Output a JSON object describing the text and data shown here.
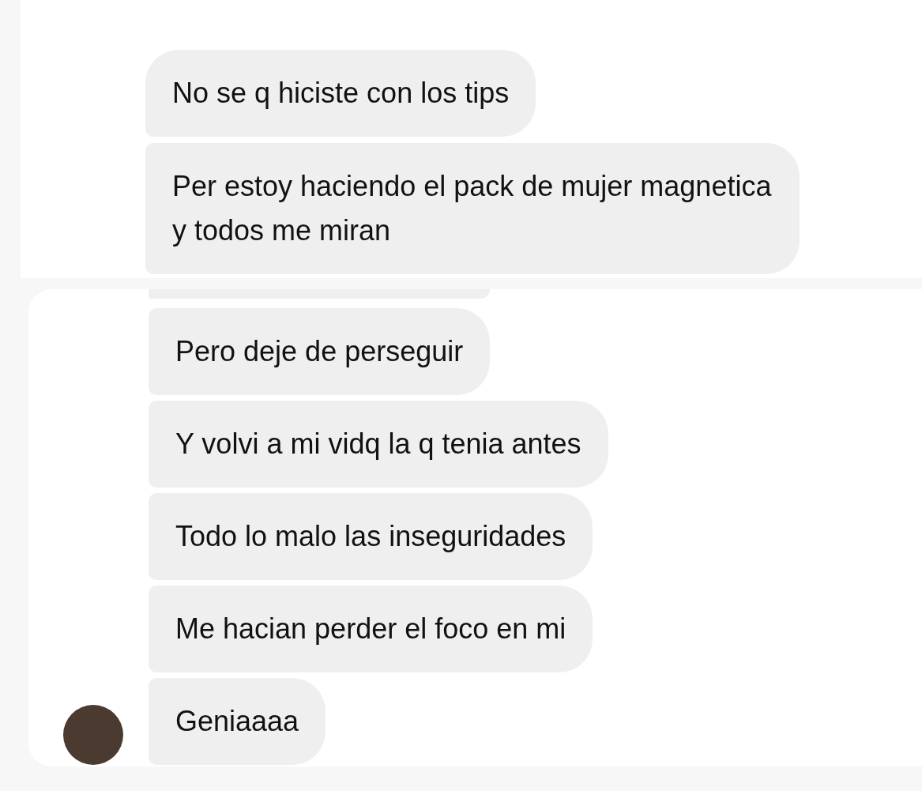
{
  "panels": [
    {
      "messages": [
        {
          "text": "No se q hiciste con los tips"
        },
        {
          "text": "Per estoy haciendo el pack de mujer magnetica y todos me miran"
        }
      ]
    },
    {
      "messages": [
        {
          "text": "Pero deje de perseguir",
          "show_avatar": false
        },
        {
          "text": "Y volvi a mi vidq la q tenia antes",
          "show_avatar": false
        },
        {
          "text": "Todo lo malo las inseguridades",
          "show_avatar": false
        },
        {
          "text": "Me hacian perder el foco en mi",
          "show_avatar": false
        },
        {
          "text": "Geniaaaa",
          "show_avatar": true
        }
      ]
    }
  ]
}
